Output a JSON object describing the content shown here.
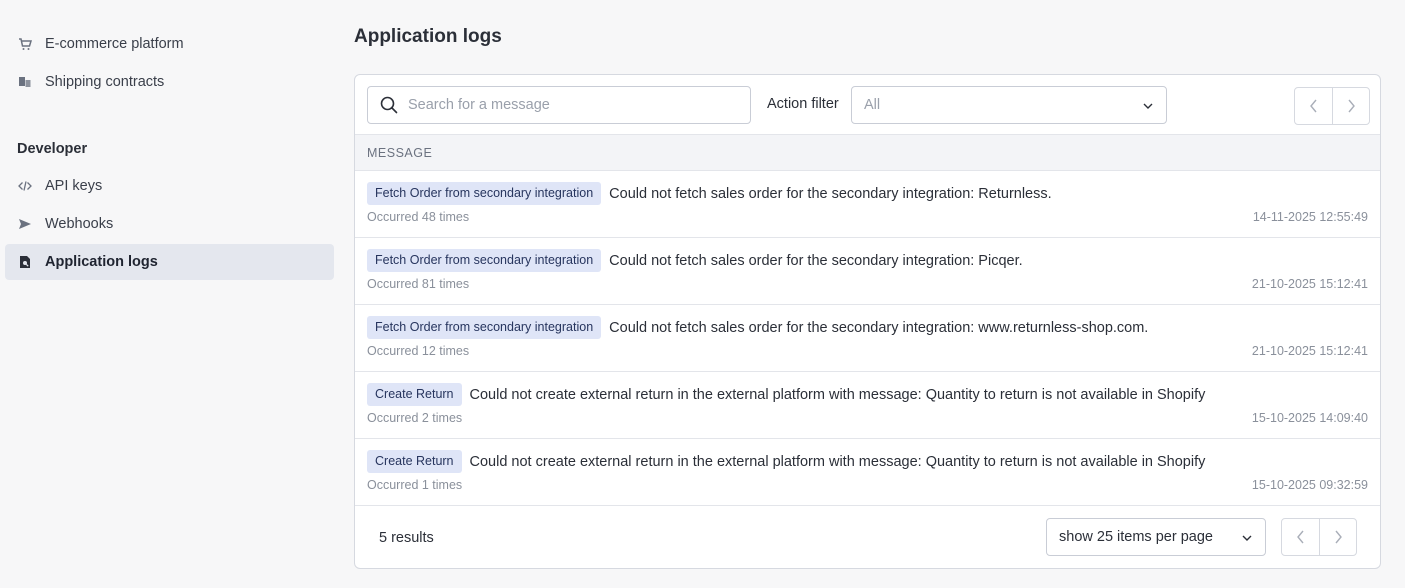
{
  "sidebar": {
    "items_top": [
      {
        "label": "E-commerce platform",
        "icon": "cart-icon"
      },
      {
        "label": "Shipping contracts",
        "icon": "contract-icon"
      }
    ],
    "developer_heading": "Developer",
    "items_dev": [
      {
        "label": "API keys",
        "icon": "code-icon"
      },
      {
        "label": "Webhooks",
        "icon": "send-icon"
      },
      {
        "label": "Application logs",
        "icon": "log-search-icon",
        "active": true
      }
    ]
  },
  "page": {
    "title": "Application logs"
  },
  "toolbar": {
    "search_placeholder": "Search for a message",
    "search_value": "",
    "filter_label": "Action filter",
    "filter_value": "All"
  },
  "table": {
    "header": "MESSAGE",
    "rows": [
      {
        "badge": "Fetch Order from secondary integration",
        "message": "Could not fetch sales order for the secondary integration: Returnless.",
        "occurrences": "Occurred 48 times",
        "timestamp": "14-11-2025 12:55:49"
      },
      {
        "badge": "Fetch Order from secondary integration",
        "message": "Could not fetch sales order for the secondary integration: Picqer.",
        "occurrences": "Occurred 81 times",
        "timestamp": "21-10-2025 15:12:41"
      },
      {
        "badge": "Fetch Order from secondary integration",
        "message": "Could not fetch sales order for the secondary integration: www.returnless-shop.com.",
        "occurrences": "Occurred 12 times",
        "timestamp": "21-10-2025 15:12:41"
      },
      {
        "badge": "Create Return",
        "message": "Could not create external return in the external platform with message: Quantity to return is not available in Shopify",
        "occurrences": "Occurred 2 times",
        "timestamp": "15-10-2025 14:09:40"
      },
      {
        "badge": "Create Return",
        "message": "Could not create external return in the external platform with message: Quantity to return is not available in Shopify",
        "occurrences": "Occurred 1 times",
        "timestamp": "15-10-2025 09:32:59"
      }
    ]
  },
  "footer": {
    "results": "5 results",
    "per_page": "show 25 items per page"
  },
  "colors": {
    "accent_badge_bg": "#dfe5f7",
    "accent_badge_text": "#27355e",
    "active_nav_bg": "#e4e7ee"
  }
}
